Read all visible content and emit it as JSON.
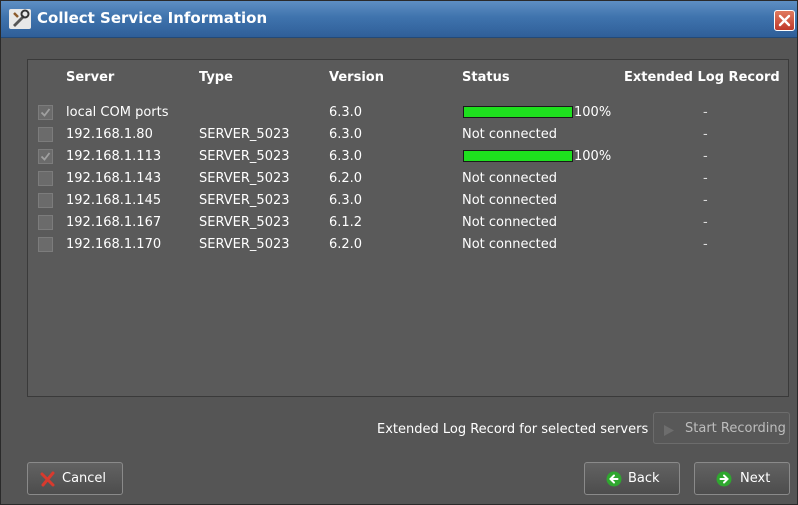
{
  "window": {
    "title": "Collect Service Information"
  },
  "columns": {
    "server": "Server",
    "type": "Type",
    "version": "Version",
    "status": "Status",
    "extended": "Extended Log Record"
  },
  "rows": [
    {
      "checked": true,
      "server": "local COM ports",
      "type": "",
      "version": "6.3.0",
      "status": "",
      "progress": 100,
      "progress_label": "100%",
      "extended": "-"
    },
    {
      "checked": false,
      "server": "192.168.1.80",
      "type": "SERVER_5023",
      "version": "6.3.0",
      "status": "Not connected",
      "progress": null,
      "progress_label": "",
      "extended": "-"
    },
    {
      "checked": true,
      "server": "192.168.1.113",
      "type": "SERVER_5023",
      "version": "6.3.0",
      "status": "",
      "progress": 100,
      "progress_label": "100%",
      "extended": "-"
    },
    {
      "checked": false,
      "server": "192.168.1.143",
      "type": "SERVER_5023",
      "version": "6.2.0",
      "status": "Not connected",
      "progress": null,
      "progress_label": "",
      "extended": "-"
    },
    {
      "checked": false,
      "server": "192.168.1.145",
      "type": "SERVER_5023",
      "version": "6.3.0",
      "status": "Not connected",
      "progress": null,
      "progress_label": "",
      "extended": "-"
    },
    {
      "checked": false,
      "server": "192.168.1.167",
      "type": "SERVER_5023",
      "version": "6.1.2",
      "status": "Not connected",
      "progress": null,
      "progress_label": "",
      "extended": "-"
    },
    {
      "checked": false,
      "server": "192.168.1.170",
      "type": "SERVER_5023",
      "version": "6.2.0",
      "status": "Not connected",
      "progress": null,
      "progress_label": "",
      "extended": "-"
    }
  ],
  "footer": {
    "extended_label": "Extended Log Record for selected servers",
    "start_recording": "Start Recording",
    "cancel": "Cancel",
    "back": "Back",
    "next": "Next"
  },
  "colors": {
    "titlebar": "#3f73ad",
    "panel": "#5a5a5a",
    "progress": "#1ee01e",
    "background": "#555555"
  },
  "icons": {
    "app": "tools-icon",
    "close": "close-icon",
    "cancel": "red-x-icon",
    "back": "green-left-arrow-icon",
    "next": "green-right-arrow-icon",
    "record": "play-icon"
  }
}
